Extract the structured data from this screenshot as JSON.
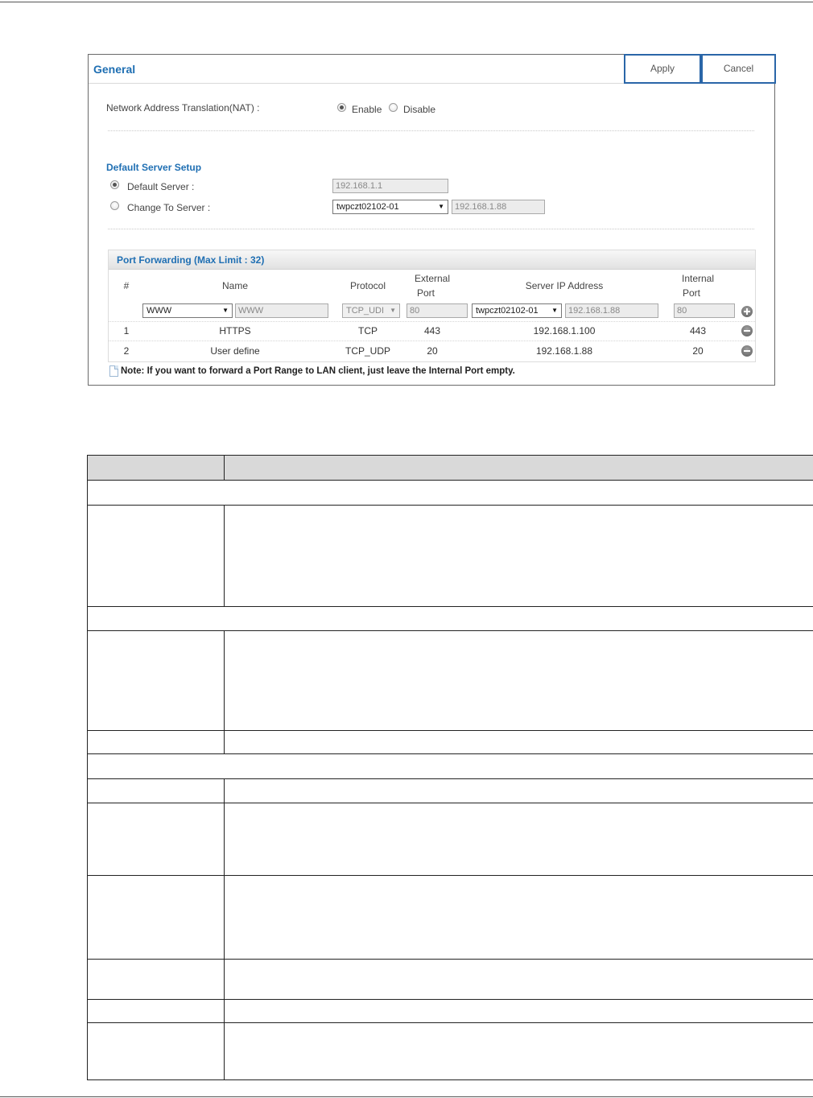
{
  "panel": {
    "title": "General",
    "apply_label": "Apply",
    "cancel_label": "Cancel"
  },
  "nat": {
    "label": "Network Address Translation(NAT) :",
    "enable_label": "Enable",
    "disable_label": "Disable",
    "selected": "Enable"
  },
  "default_server_setup": {
    "title": "Default Server Setup",
    "default_server_label": "Default Server :",
    "default_server_value": "192.168.1.1",
    "change_to_server_label": "Change To Server :",
    "change_to_server_select": "twpczt02102-01",
    "change_to_server_ip": "192.168.1.88",
    "selected": "Default Server"
  },
  "port_forwarding": {
    "title": "Port Forwarding (Max Limit : 32)",
    "headers": {
      "num": "#",
      "name": "Name",
      "protocol": "Protocol",
      "external_port_1": "External",
      "external_port_2": "Port",
      "server_ip": "Server IP Address",
      "internal_port_1": "Internal",
      "internal_port_2": "Port"
    },
    "new_entry": {
      "name_select": "WWW",
      "name_value": "WWW",
      "protocol": "TCP_UDI",
      "external_port": "80",
      "server_select": "twpczt02102-01",
      "server_ip": "192.168.1.88",
      "internal_port": "80"
    },
    "rows": [
      {
        "num": "1",
        "name": "HTTPS",
        "protocol": "TCP",
        "external_port": "443",
        "server_ip": "192.168.1.100",
        "internal_port": "443"
      },
      {
        "num": "2",
        "name": "User define",
        "protocol": "TCP_UDP",
        "external_port": "20",
        "server_ip": "192.168.1.88",
        "internal_port": "20"
      }
    ]
  },
  "note": "Note: If you want to forward a Port Range to LAN client, just leave the Internal Port empty.",
  "icons": {
    "add": "plus-circle-icon",
    "delete": "minus-circle-icon",
    "note": "note-icon",
    "dropdown": "chevron-down-icon"
  },
  "colors": {
    "accent_blue": "#1f6fb3",
    "button_border": "#2a66a8",
    "table_header_bg": "#d9d9d9"
  }
}
